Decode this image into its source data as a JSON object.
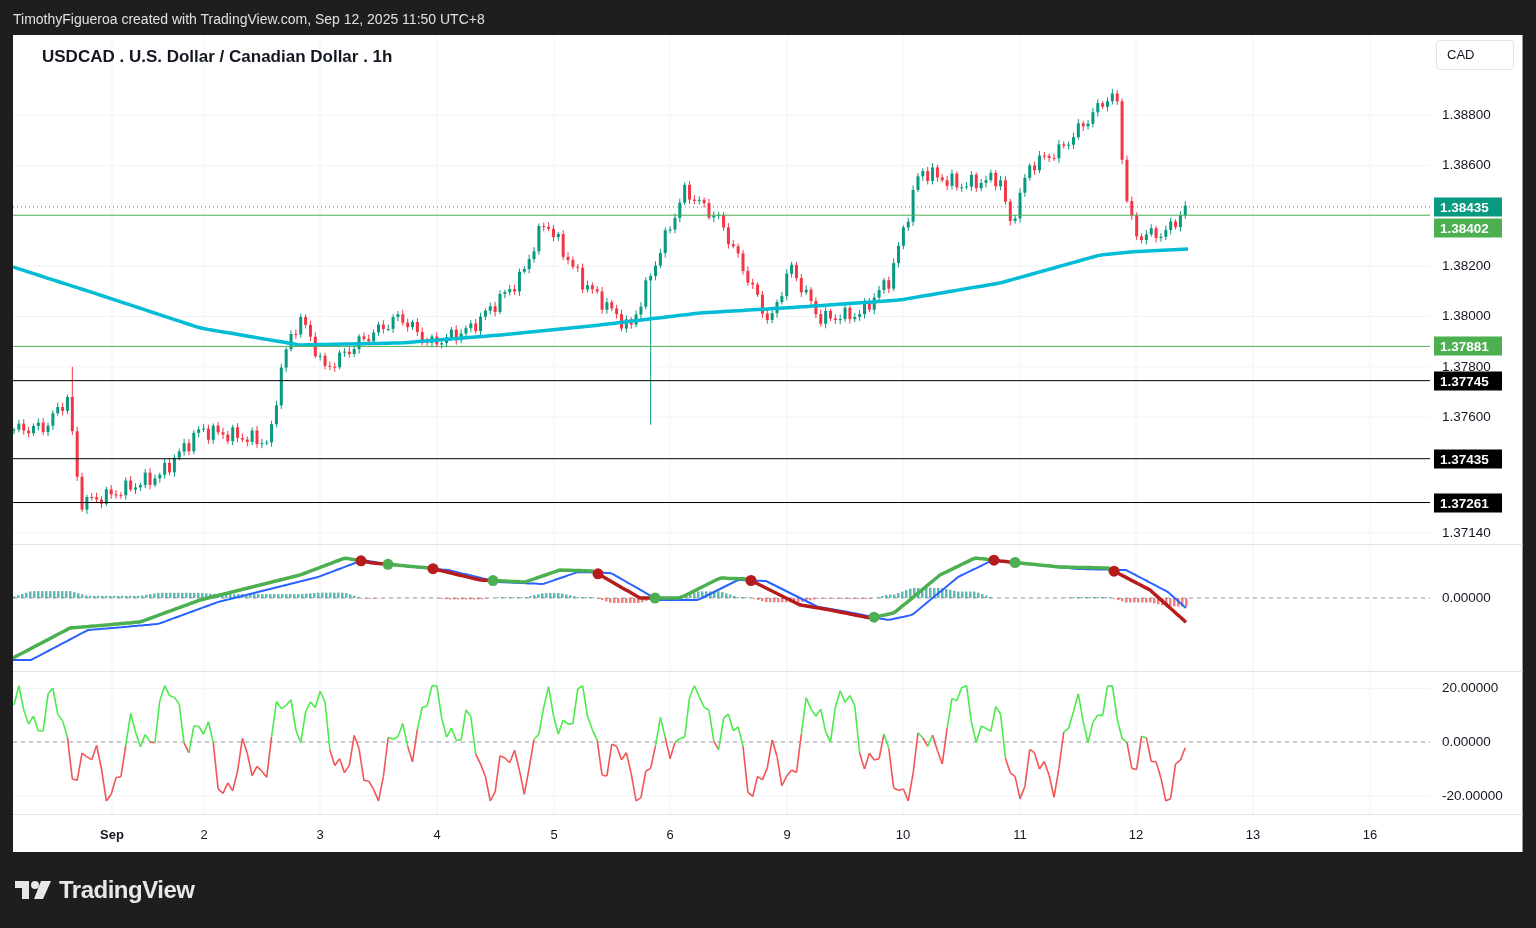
{
  "header": {
    "credit": "TimothyFigueroa created with TradingView.com, Sep 12, 2025 11:50 UTC+8"
  },
  "chart": {
    "title": "USDCAD . U.S. Dollar / Canadian Dollar . 1h",
    "currency": "CAD",
    "price_axis": {
      "ticks": [
        "1.38800",
        "1.38600",
        "1.38200",
        "1.38000",
        "1.37800",
        "1.37600",
        "1.37140"
      ]
    },
    "price_lines": [
      {
        "label": "1.38435",
        "color": "#089981",
        "kind": "dotted"
      },
      {
        "label": "1.38402",
        "color": "#4caf50",
        "kind": "solid"
      },
      {
        "label": "1.37881",
        "color": "#4caf50",
        "kind": "solid"
      },
      {
        "label": "1.37745",
        "color": "#000000",
        "kind": "solid"
      },
      {
        "label": "1.37435",
        "color": "#000000",
        "kind": "solid"
      },
      {
        "label": "1.37261",
        "color": "#000000",
        "kind": "solid"
      }
    ],
    "oscillator_axis": {
      "ticks": [
        "0.00000"
      ]
    },
    "momentum_axis": {
      "ticks": [
        "20.00000",
        "0.00000",
        "-20.00000"
      ]
    },
    "time_axis": {
      "labels": [
        {
          "label": "Sep",
          "bold": true
        },
        {
          "label": "2",
          "bold": false
        },
        {
          "label": "3",
          "bold": false
        },
        {
          "label": "4",
          "bold": false
        },
        {
          "label": "5",
          "bold": false
        },
        {
          "label": "6",
          "bold": false
        },
        {
          "label": "9",
          "bold": false
        },
        {
          "label": "10",
          "bold": false
        },
        {
          "label": "11",
          "bold": false
        },
        {
          "label": "12",
          "bold": false
        },
        {
          "label": "13",
          "bold": false
        },
        {
          "label": "16",
          "bold": false
        }
      ]
    }
  },
  "footer": {
    "brand": "TradingView"
  }
}
